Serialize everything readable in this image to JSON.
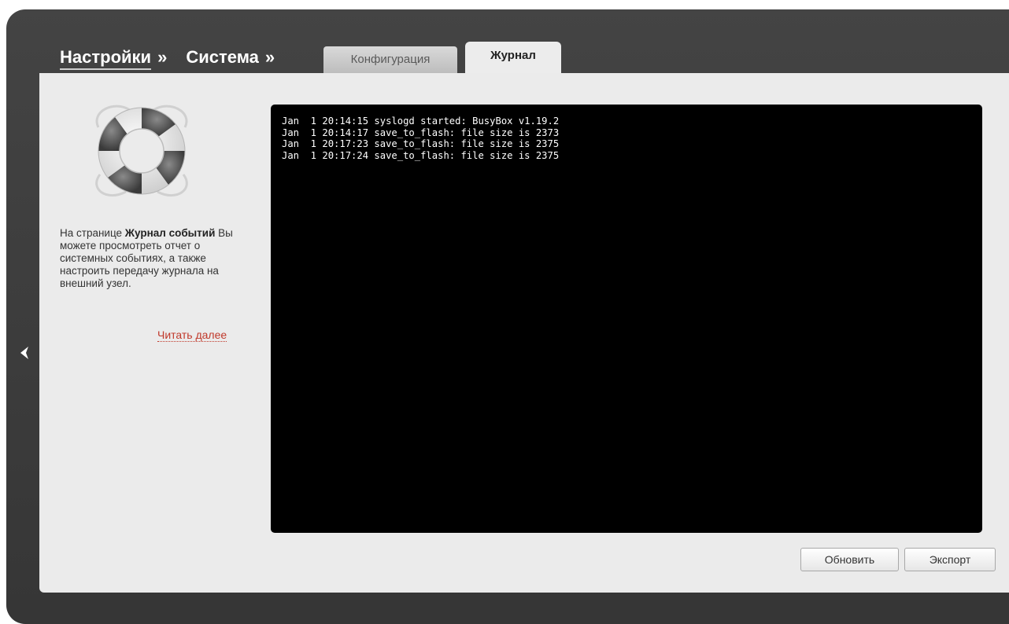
{
  "breadcrumb": {
    "settings": "Настройки",
    "sep1": "»",
    "system": "Система",
    "sep2": "»"
  },
  "tabs": [
    {
      "label": "Конфигурация",
      "active": false
    },
    {
      "label": "Журнал",
      "active": true
    }
  ],
  "help": {
    "pre": "На странице ",
    "bold": "Журнал событий",
    "post": " Вы можете просмотреть отчет о системных событиях, а также настроить передачу журнала на внешний узел.",
    "read_more": "Читать далее"
  },
  "log": {
    "lines": [
      "Jan  1 20:14:15 syslogd started: BusyBox v1.19.2",
      "Jan  1 20:14:17 save_to_flash: file size is 2373",
      "Jan  1 20:17:23 save_to_flash: file size is 2375",
      "Jan  1 20:17:24 save_to_flash: file size is 2375"
    ]
  },
  "buttons": {
    "refresh": "Обновить",
    "export": "Экспорт"
  },
  "icons": {
    "help_illustration": "lifebuoy-icon",
    "collapse": "chevron-left-icon"
  },
  "colors": {
    "frame": "#3c3c3c",
    "panel": "#ebebeb",
    "log_bg": "#000000",
    "link": "#c0392b"
  }
}
